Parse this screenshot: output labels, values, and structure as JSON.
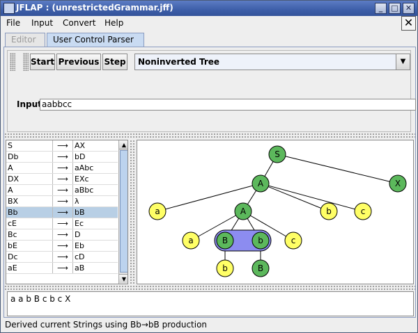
{
  "window": {
    "title": "JFLAP : (unrestrictedGrammar.jff)",
    "min_glyph": "_",
    "max_glyph": "□",
    "close_glyph": "✕"
  },
  "menubar": {
    "items": [
      "File",
      "Input",
      "Convert",
      "Help"
    ],
    "close_label": "✕"
  },
  "tabs": {
    "editor": "Editor",
    "parser": "User Control Parser"
  },
  "toolbar": {
    "start": "Start",
    "previous": "Previous",
    "step": "Step",
    "view_select": "Noninverted Tree"
  },
  "input": {
    "label": "Input",
    "value": "aabbcc"
  },
  "productions": [
    {
      "lhs": "S",
      "arrow": "⟶",
      "rhs": "AX"
    },
    {
      "lhs": "Db",
      "arrow": "⟶",
      "rhs": "bD"
    },
    {
      "lhs": "A",
      "arrow": "⟶",
      "rhs": "aAbc"
    },
    {
      "lhs": "DX",
      "arrow": "⟶",
      "rhs": "EXc"
    },
    {
      "lhs": "A",
      "arrow": "⟶",
      "rhs": "aBbc"
    },
    {
      "lhs": "BX",
      "arrow": "⟶",
      "rhs": "λ"
    },
    {
      "lhs": "Bb",
      "arrow": "⟶",
      "rhs": "bB"
    },
    {
      "lhs": "cE",
      "arrow": "⟶",
      "rhs": "Ec"
    },
    {
      "lhs": "Bc",
      "arrow": "⟶",
      "rhs": "D"
    },
    {
      "lhs": "bE",
      "arrow": "⟶",
      "rhs": "Eb"
    },
    {
      "lhs": "Dc",
      "arrow": "⟶",
      "rhs": "cD"
    },
    {
      "lhs": "aE",
      "arrow": "⟶",
      "rhs": "aB"
    }
  ],
  "selected_production_index": 6,
  "tree": {
    "nodes": [
      {
        "id": "n1",
        "label": "S",
        "type": "variable"
      },
      {
        "id": "n2",
        "label": "A",
        "type": "variable"
      },
      {
        "id": "n3",
        "label": "X",
        "type": "variable"
      },
      {
        "id": "n4",
        "label": "a",
        "type": "terminal"
      },
      {
        "id": "n5",
        "label": "A",
        "type": "variable"
      },
      {
        "id": "n6",
        "label": "b",
        "type": "terminal"
      },
      {
        "id": "n7",
        "label": "c",
        "type": "terminal"
      },
      {
        "id": "n8",
        "label": "a",
        "type": "terminal"
      },
      {
        "id": "n9",
        "label": "B",
        "type": "variable"
      },
      {
        "id": "n10",
        "label": "b",
        "type": "variable"
      },
      {
        "id": "n11",
        "label": "c",
        "type": "terminal"
      },
      {
        "id": "n12",
        "label": "b",
        "type": "terminal"
      },
      {
        "id": "n13",
        "label": "B",
        "type": "variable"
      }
    ],
    "edges": [
      [
        "n1",
        "n2"
      ],
      [
        "n1",
        "n3"
      ],
      [
        "n2",
        "n4"
      ],
      [
        "n2",
        "n5"
      ],
      [
        "n2",
        "n6"
      ],
      [
        "n2",
        "n7"
      ],
      [
        "n5",
        "n8"
      ],
      [
        "n5",
        "n9"
      ],
      [
        "n5",
        "n10"
      ],
      [
        "n5",
        "n11"
      ],
      [
        "n9",
        "n12"
      ],
      [
        "n10",
        "n13"
      ]
    ],
    "highlight_group": [
      "n9",
      "n10"
    ],
    "colors": {
      "variable": "#5cb85c",
      "terminal": "#ffff66",
      "highlight": "#8c8cf0"
    }
  },
  "derivation": {
    "current_string": "a a b B c b c X"
  },
  "status": {
    "text": "Derived current Strings using Bb→bB production"
  }
}
